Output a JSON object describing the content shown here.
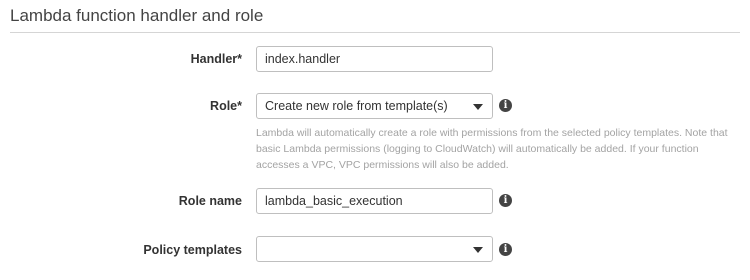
{
  "section": {
    "title": "Lambda function handler and role"
  },
  "handler": {
    "label": "Handler*",
    "value": "index.handler"
  },
  "role": {
    "label": "Role*",
    "selected": "Create new role from template(s)",
    "help_text": "Lambda will automatically create a role with permissions from the selected policy templates. Note that basic Lambda permissions (logging to CloudWatch) will automatically be added. If your function accesses a VPC, VPC permissions will also be added."
  },
  "role_name": {
    "label": "Role name",
    "value": "lambda_basic_execution"
  },
  "policy_templates": {
    "label": "Policy templates",
    "selected": ""
  },
  "icons": {
    "info": "info-icon",
    "dropdown": "chevron-down-icon"
  }
}
